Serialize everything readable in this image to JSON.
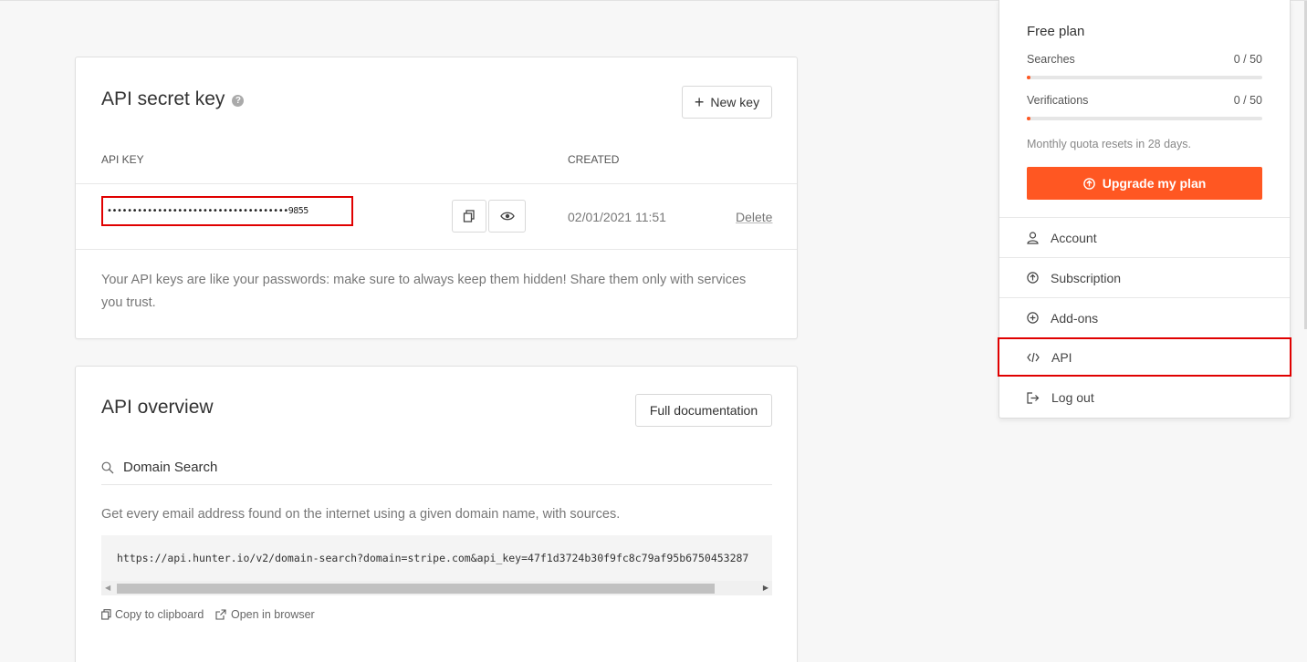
{
  "secret_key": {
    "title": "API secret key",
    "new_key_label": "New key",
    "col_api_key": "API KEY",
    "col_created": "CREATED",
    "masked_key": "••••••••••••••••••••••••••••••••••••9855",
    "created": "02/01/2021 11:51",
    "delete_label": "Delete",
    "note": "Your API keys are like your passwords: make sure to always keep them hidden! Share them only with services you trust."
  },
  "overview": {
    "title": "API overview",
    "docs_label": "Full documentation",
    "section_title": "Domain Search",
    "description": "Get every email address found on the internet using a given domain name, with sources.",
    "example_url": "https://api.hunter.io/v2/domain-search?domain=stripe.com&api_key=47f1d3724b30f9fc8c79af95b6750453287",
    "copy_label": "Copy to clipboard",
    "open_label": "Open in browser"
  },
  "plan": {
    "name": "Free plan",
    "searches_label": "Searches",
    "searches_value": "0 / 50",
    "searches_fraction": 0.015,
    "verifications_label": "Verifications",
    "verifications_value": "0 / 50",
    "verifications_fraction": 0.015,
    "reset_note": "Monthly quota resets in 28 days.",
    "upgrade_label": "Upgrade my plan"
  },
  "menu": {
    "account": "Account",
    "subscription": "Subscription",
    "addons": "Add-ons",
    "api": "API",
    "logout": "Log out"
  },
  "colors": {
    "accent": "#ff5722",
    "highlight": "#e00000"
  }
}
